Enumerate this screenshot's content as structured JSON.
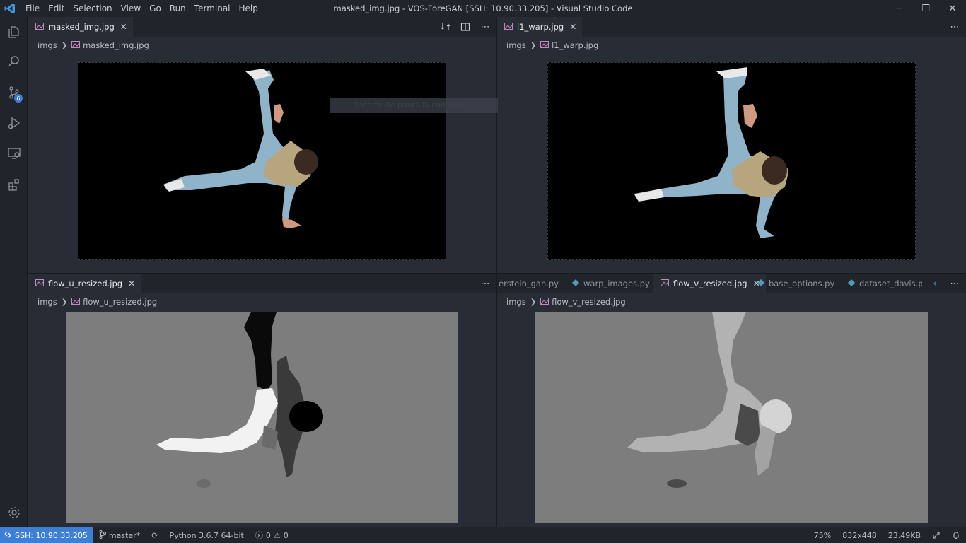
{
  "window": {
    "title": "masked_img.jpg - VOS-ForeGAN [SSH: 10.90.33.205] - Visual Studio Code",
    "menu": [
      "File",
      "Edit",
      "Selection",
      "View",
      "Go",
      "Run",
      "Terminal",
      "Help"
    ],
    "controls": {
      "minimize": "─",
      "restore": "❐",
      "close": "✕"
    }
  },
  "activitybar": {
    "icons": [
      "explorer-icon",
      "search-icon",
      "source-control-icon",
      "run-debug-icon",
      "remote-explorer-icon",
      "extensions-icon",
      "settings-gear-icon"
    ],
    "source_control_badge": "6"
  },
  "groups": {
    "top_left": {
      "tabs": [
        {
          "label": "masked_img.jpg",
          "active": true,
          "close": "✕"
        }
      ],
      "breadcrumb": [
        "imgs",
        "masked_img.jpg"
      ],
      "actions": [
        "compare-icon",
        "split-editor-icon",
        "more-actions-icon"
      ]
    },
    "top_right": {
      "tabs": [
        {
          "label": "l1_warp.jpg",
          "active": true,
          "close": "✕"
        }
      ],
      "breadcrumb": [
        "imgs",
        "l1_warp.jpg"
      ],
      "actions": [
        "more-actions-icon"
      ]
    },
    "bottom_left": {
      "tabs": [
        {
          "label": "flow_u_resized.jpg",
          "active": true,
          "close": "✕"
        }
      ],
      "breadcrumb": [
        "imgs",
        "flow_u_resized.jpg"
      ],
      "actions": [
        "more-actions-icon"
      ]
    },
    "bottom_right": {
      "tabs": [
        {
          "label": "erstein_gan.py",
          "active": false
        },
        {
          "label": "warp_images.py",
          "active": false
        },
        {
          "label": "flow_v_resized.jpg",
          "active": true,
          "close": "✕"
        },
        {
          "label": "base_options.py",
          "active": false
        },
        {
          "label": "dataset_davis.py",
          "active": false
        }
      ],
      "breadcrumb": [
        "imgs",
        "flow_v_resized.jpg"
      ],
      "actions": [
        "more-actions-icon"
      ]
    }
  },
  "tooltip": "Recorte de pantalla completa",
  "statusbar": {
    "remote": "SSH: 10.90.33.205",
    "branch": "master*",
    "python": "Python 3.6.7 64-bit",
    "errors": "0",
    "warnings": "0",
    "zoom": "75%",
    "dimensions": "832x448",
    "filesize": "23.49KB"
  },
  "colors": {
    "accent": "#3d7fd6",
    "image_icon": "#c586c0",
    "python_icon": "#519aba"
  }
}
